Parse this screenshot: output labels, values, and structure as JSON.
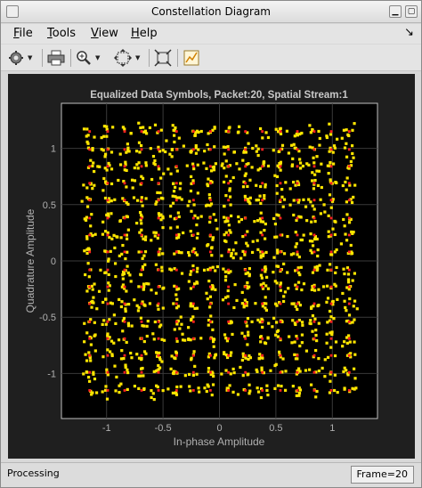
{
  "window": {
    "title": "Constellation Diagram"
  },
  "menu": [
    {
      "key": "F",
      "rest": "ile"
    },
    {
      "key": "T",
      "rest": "ools"
    },
    {
      "key": "V",
      "rest": "iew"
    },
    {
      "key": "H",
      "rest": "elp"
    }
  ],
  "toolbar": {
    "icons": [
      "gear-icon",
      "print-icon",
      "zoom-in-icon",
      "fit-axes-icon",
      "autoscale-icon",
      "highlight-icon"
    ]
  },
  "chart_data": {
    "type": "scatter",
    "title": "Equalized Data Symbols, Packet:20, Spatial Stream:1",
    "xlabel": "In-phase Amplitude",
    "ylabel": "Quadrature Amplitude",
    "xlim": [
      -1.4,
      1.4
    ],
    "ylim": [
      -1.4,
      1.4
    ],
    "xticks": [
      -1,
      -0.5,
      0,
      0.5,
      1
    ],
    "yticks": [
      -1,
      -0.5,
      0,
      0.5,
      1
    ],
    "grid": true,
    "modulation_levels": [
      -1.15,
      -0.99,
      -0.84,
      -0.69,
      -0.54,
      -0.38,
      -0.23,
      -0.08,
      0.08,
      0.23,
      0.38,
      0.54,
      0.69,
      0.84,
      0.99,
      1.15
    ],
    "reference_color": "#ff2020",
    "symbol_color": "#ffe600",
    "background": "#000000",
    "axes_color": "#b8b8b8"
  },
  "status": {
    "left": "Processing",
    "frame": "Frame=20"
  }
}
